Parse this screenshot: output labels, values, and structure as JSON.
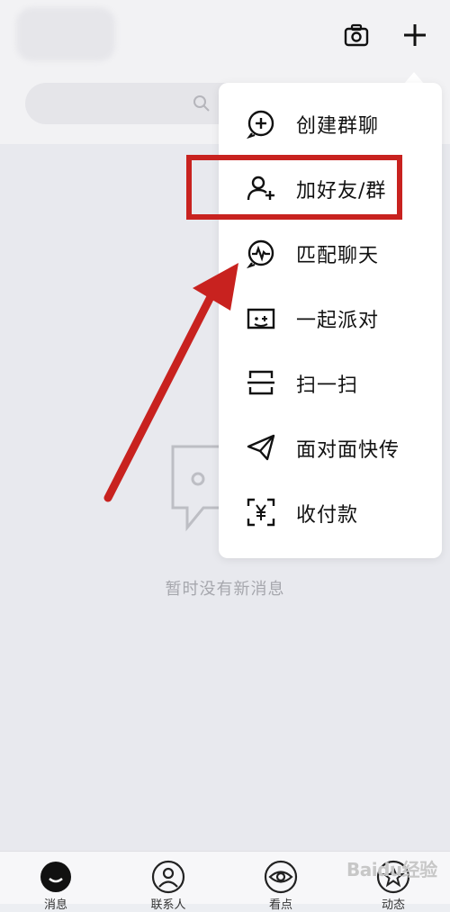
{
  "menu": {
    "items": [
      {
        "label": "创建群聊",
        "icon": "add-circle-icon"
      },
      {
        "label": "加好友/群",
        "icon": "add-user-icon"
      },
      {
        "label": "匹配聊天",
        "icon": "pulse-circle-icon"
      },
      {
        "label": "一起派对",
        "icon": "party-game-icon"
      },
      {
        "label": "扫一扫",
        "icon": "scan-icon"
      },
      {
        "label": "面对面快传",
        "icon": "paper-plane-icon"
      },
      {
        "label": "收付款",
        "icon": "payment-scan-icon"
      }
    ]
  },
  "empty_state": {
    "text": "暂时没有新消息"
  },
  "tabbar": {
    "tabs": [
      {
        "label": "消息",
        "icon": "message-icon"
      },
      {
        "label": "联系人",
        "icon": "contacts-icon"
      },
      {
        "label": "看点",
        "icon": "eye-icon"
      },
      {
        "label": "动态",
        "icon": "star-icon"
      }
    ]
  },
  "watermark": {
    "text": "Baidu经验"
  },
  "colors": {
    "annotation": "#c8221f",
    "accent": "#111111"
  }
}
